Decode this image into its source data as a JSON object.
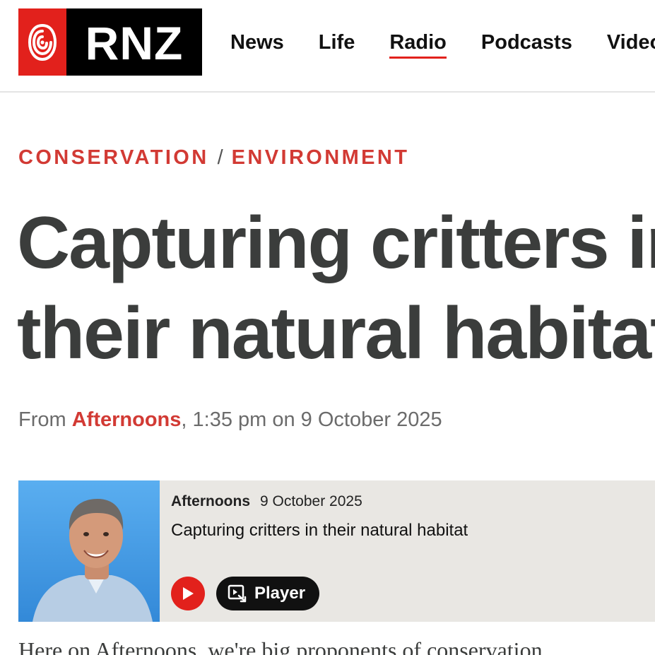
{
  "brand": {
    "logo_text": "RNZ",
    "accent_color": "#e2211c",
    "icon": "rnz-swirl-icon"
  },
  "nav": {
    "items": [
      {
        "label": "News",
        "active": false
      },
      {
        "label": "Life",
        "active": false
      },
      {
        "label": "Radio",
        "active": true
      },
      {
        "label": "Podcasts",
        "active": false
      },
      {
        "label": "Video",
        "active": false
      }
    ]
  },
  "article": {
    "categories": [
      "CONSERVATION",
      "ENVIRONMENT"
    ],
    "category_separator": "/",
    "headline": "Capturing critters in their natural habitat",
    "byline": {
      "prefix": "From",
      "program": "Afternoons",
      "time": ", 1:35 pm on 9 October 2025"
    },
    "body_start": "Here on Afternoons, we're big proponents of conservation"
  },
  "audio_card": {
    "program": "Afternoons",
    "date": "9 October 2025",
    "title": "Capturing critters in their natural habitat",
    "play_icon": "play-icon",
    "player_label": "Player",
    "player_icon": "open-player-icon",
    "photo": "presenter-portrait"
  }
}
